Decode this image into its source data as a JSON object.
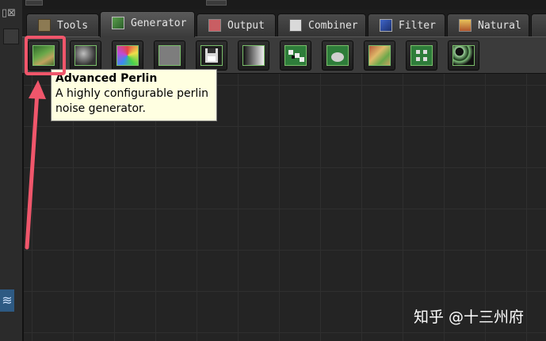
{
  "tabs": [
    {
      "label": "Tools",
      "icon": "tools-icon"
    },
    {
      "label": "Generator",
      "icon": "generator-icon"
    },
    {
      "label": "Output",
      "icon": "output-icon"
    },
    {
      "label": "Combiner",
      "icon": "combiner-icon"
    },
    {
      "label": "Filter",
      "icon": "filter-icon"
    },
    {
      "label": "Natural",
      "icon": "natural-icon"
    }
  ],
  "active_tab": "Generator",
  "toolbar": {
    "buttons": [
      {
        "name": "advanced-perlin",
        "icon": "terrain-icon"
      },
      {
        "name": "gradient-noise",
        "icon": "noise-icon"
      },
      {
        "name": "color-noise",
        "icon": "color-noise-icon"
      },
      {
        "name": "constant",
        "icon": "constant-icon"
      },
      {
        "name": "file-input",
        "icon": "floppy-disk-icon"
      },
      {
        "name": "gradient",
        "icon": "gradient-icon"
      },
      {
        "name": "checker",
        "icon": "checker-icon"
      },
      {
        "name": "hill",
        "icon": "hill-icon"
      },
      {
        "name": "voronoi",
        "icon": "voronoi-icon"
      },
      {
        "name": "grid",
        "icon": "grid-icon"
      },
      {
        "name": "cellular",
        "icon": "cellular-icon"
      }
    ]
  },
  "tooltip": {
    "title": "Advanced Perlin",
    "line1": "A highly configurable perlin",
    "line2": "noise generator."
  },
  "annotation": {
    "color": "#f0566b"
  },
  "watermark": "知乎 @十三州府"
}
